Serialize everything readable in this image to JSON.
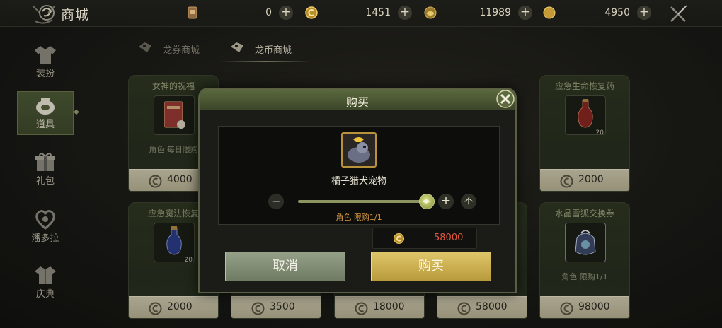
{
  "header": {
    "title": "商城",
    "currencies": [
      {
        "icon": "ticket-icon",
        "value": "0"
      },
      {
        "icon": "dragon-coin-icon",
        "value": "1451"
      },
      {
        "icon": "gold-ingot-icon",
        "value": "11989"
      },
      {
        "icon": "gold-coin-icon",
        "value": "4950"
      }
    ]
  },
  "sidebar": {
    "items": [
      {
        "label": "装扮",
        "icon": "outfit-icon"
      },
      {
        "label": "道具",
        "icon": "pouch-icon",
        "active": true
      },
      {
        "label": "礼包",
        "icon": "gift-icon"
      },
      {
        "label": "潘多拉",
        "icon": "heart-icon"
      },
      {
        "label": "庆典",
        "icon": "robe-icon"
      }
    ]
  },
  "tabs": [
    {
      "label": "龙券商城",
      "active": false
    },
    {
      "label": "龙币商城",
      "active": true
    }
  ],
  "cards": [
    {
      "name": "女神的祝福",
      "limit": "角色 每日限购",
      "price": "4000",
      "qty": ""
    },
    {
      "name": "应急生命恢复药",
      "limit": "",
      "price": "2000",
      "qty": "20"
    },
    {
      "name": "应急魔法恢复",
      "limit": "",
      "price": "2000",
      "qty": "20"
    },
    {
      "name": "",
      "limit": "",
      "price": "3500",
      "qty": ""
    },
    {
      "name": "",
      "limit": "",
      "price": "18000",
      "qty": ""
    },
    {
      "name": "",
      "limit": "",
      "price": "58000",
      "qty": ""
    },
    {
      "name": "水晶雪狐交换券",
      "limit": "角色 限购1/1",
      "price": "98000",
      "qty": ""
    }
  ],
  "modal": {
    "title": "购买",
    "item_name": "橘子猎犬宠物",
    "minus": "−",
    "plus": "+",
    "max": "不",
    "slider_fraction": 1.0,
    "limit": "角色 限购1/1",
    "total": "58000",
    "cancel_label": "取消",
    "buy_label": "购买"
  },
  "colors": {
    "accent_green": "#5b6a3f",
    "price_red": "#e2563d",
    "gold": "#e0c66a",
    "limit_orange": "#d99945"
  }
}
